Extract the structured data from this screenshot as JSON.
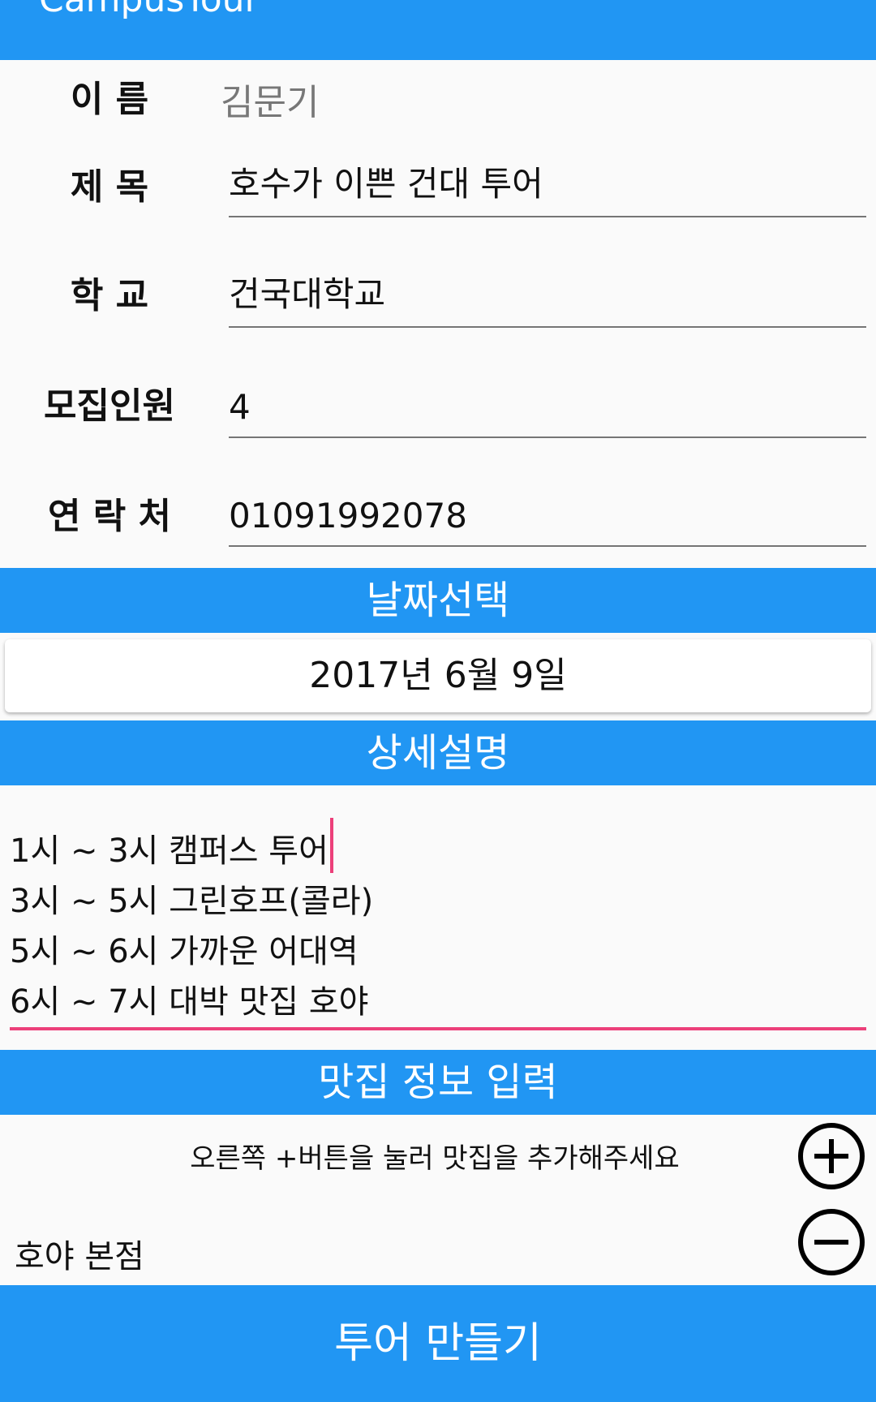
{
  "app_bar": {
    "title": "CampusTour"
  },
  "form": {
    "name_label": "이 름",
    "name_value": "김문기",
    "title_label": "제 목",
    "title_value": "호수가 이쁜 건대 투어",
    "school_label": "학 교",
    "school_value": "건국대학교",
    "capacity_label": "모집인원",
    "capacity_value": "4",
    "contact_label": "연 락 처",
    "contact_value": "01091992078"
  },
  "date_section": {
    "header": "날짜선택",
    "selected_date": "2017년 6월 9일"
  },
  "description_section": {
    "header": "상세설명",
    "lines": [
      "1시 ~ 3시 캠퍼스 투어",
      "3시 ~ 5시 그린호프(콜라)",
      "5시 ~ 6시 가까운 어대역",
      "6시 ~ 7시 대박 맛집 호야"
    ]
  },
  "restaurant_section": {
    "header": "맛집 정보 입력",
    "hint": "오른쪽 +버튼을 눌러 맛집을 추가해주세요",
    "items": [
      "호야 본점"
    ]
  },
  "submit_button": {
    "label": "투어 만들기"
  },
  "colors": {
    "primary": "#2196f3",
    "accent": "#ec407a",
    "background": "#fafafa"
  },
  "icons": {
    "add": "plus-circle-icon",
    "remove": "minus-circle-icon"
  }
}
